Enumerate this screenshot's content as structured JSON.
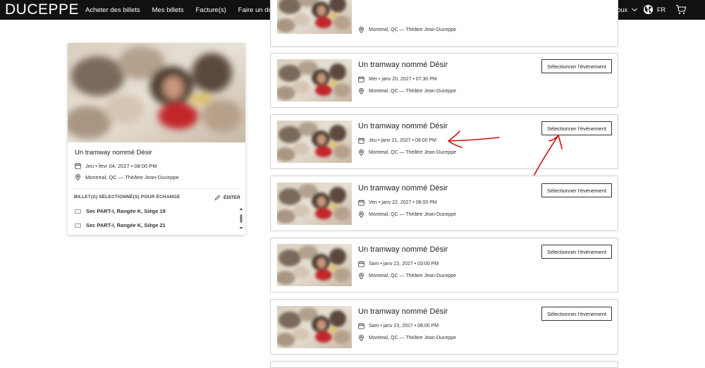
{
  "header": {
    "logo": "DUCEPPE",
    "nav": [
      "Acheter des billets",
      "Mes billets",
      "Facture(s)",
      "Faire un don"
    ],
    "user_initial": "M",
    "user_name": "Marie-Josée Rioux",
    "lang": "FR"
  },
  "summary": {
    "title": "Un tramway nommé Désir",
    "datetime": "Jeu • févr 04, 2027 • 08:00 PM",
    "venue": "Montreal, QC — Théâtre Jean-Duceppe",
    "selected_label": "BILLET(S) SÉLECTIONNÉ(S) POUR ÉCHANGE",
    "edit_label": "ÉDITER",
    "seats": [
      "Sec PART-I, Rangée K, Siège 19",
      "Sec PART-I, Rangée K, Siège 21"
    ]
  },
  "events": [
    {
      "title": "",
      "datetime": "",
      "venue": "Montreal, QC — Théâtre Jean-Duceppe",
      "button": ""
    },
    {
      "title": "Un tramway nommé Désir",
      "datetime": "Mer • janv 20, 2027 • 07:30 PM",
      "venue": "Montreal, QC — Théâtre Jean-Duceppe",
      "button": "Sélectionner l'événement"
    },
    {
      "title": "Un tramway nommé Désir",
      "datetime": "Jeu • janv 21, 2027 • 08:00 PM",
      "venue": "Montreal, QC — Théâtre Jean-Duceppe",
      "button": "Sélectionner l'événement"
    },
    {
      "title": "Un tramway nommé Désir",
      "datetime": "Ven • janv 22, 2027 • 08:00 PM",
      "venue": "Montreal, QC — Théâtre Jean-Duceppe",
      "button": "Sélectionner l'événement"
    },
    {
      "title": "Un tramway nommé Désir",
      "datetime": "Sam • janv 23, 2027 • 03:00 PM",
      "venue": "Montreal, QC — Théâtre Jean-Duceppe",
      "button": "Sélectionner l'événement"
    },
    {
      "title": "Un tramway nommé Désir",
      "datetime": "Sam • janv 23, 2027 • 08:00 PM",
      "venue": "Montreal, QC — Théâtre Jean-Duceppe",
      "button": "Sélectionner l'événement"
    }
  ],
  "colors": {
    "topbar": "#111111",
    "annotation": "#cc1111",
    "card_border": "#cfcfcf"
  }
}
